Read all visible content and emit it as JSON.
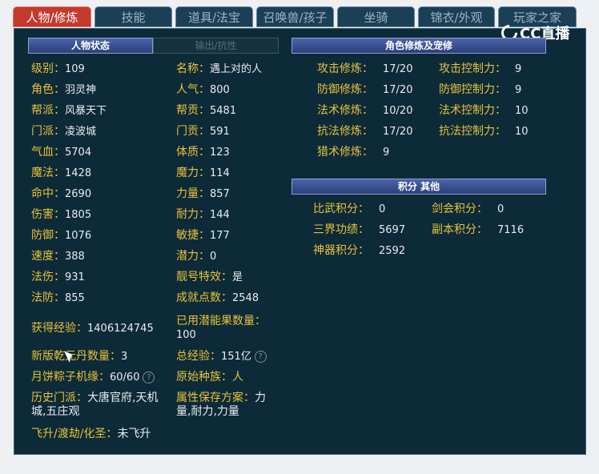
{
  "tabs": [
    "人物/修炼",
    "技能",
    "道具/法宝",
    "召唤兽/孩子",
    "坐骑",
    "锦衣/外观",
    "玩家之家"
  ],
  "logo_text": "CC直播",
  "section_headers": {
    "status_tab": "人物状态",
    "output_tab": "输出/抗性",
    "cultivation": "角色修炼及宠修",
    "points": "积分 其他"
  },
  "left_col": [
    {
      "label": "级别：",
      "value": "109"
    },
    {
      "label": "角色：",
      "value": "羽灵神"
    },
    {
      "label": "帮派：",
      "value": "风暴天下"
    },
    {
      "label": "门派：",
      "value": "凌波城"
    },
    {
      "label": "气血：",
      "value": "5704"
    },
    {
      "label": "魔法：",
      "value": "1428"
    },
    {
      "label": "命中：",
      "value": "2690"
    },
    {
      "label": "伤害：",
      "value": "1805"
    },
    {
      "label": "防御：",
      "value": "1076"
    },
    {
      "label": "速度：",
      "value": "388"
    },
    {
      "label": "法伤：",
      "value": "931"
    },
    {
      "label": "法防：",
      "value": "855"
    }
  ],
  "right_col": [
    {
      "label": "名称：",
      "value": "遇上对的人"
    },
    {
      "label": "人气：",
      "value": "800"
    },
    {
      "label": "帮贡：",
      "value": "5481"
    },
    {
      "label": "门贡：",
      "value": "591"
    },
    {
      "label": "体质：",
      "value": "123"
    },
    {
      "label": "魔力：",
      "value": "114"
    },
    {
      "label": "力量：",
      "value": "857"
    },
    {
      "label": "耐力：",
      "value": "144"
    },
    {
      "label": "敏捷：",
      "value": "177"
    },
    {
      "label": "潜力：",
      "value": "0"
    },
    {
      "label": "靓号特效：",
      "value": "是"
    },
    {
      "label": "成就点数：",
      "value": "2548"
    }
  ],
  "extra": {
    "exp_label": "获得经验：",
    "exp_value": "1406124745",
    "potential_label": "已用潜能果数量：",
    "potential_value": "100",
    "qiankun_label": "新版乾元丹数量：",
    "qiankun_value": "3",
    "total_exp_label": "总经验：",
    "total_exp_value": "151亿",
    "mooncake_label": "月饼粽子机缘：",
    "mooncake_value": "60/60",
    "race_label": "原始种族：",
    "race_value": "人",
    "history_label": "历史门派：",
    "history_value": "大唐官府,天机城,五庄观",
    "scheme_label": "属性保存方案：",
    "scheme_value": "力量,耐力,力量",
    "ascend_label": "飞升/渡劫/化圣：",
    "ascend_value": "未飞升"
  },
  "cultivation": [
    {
      "label": "攻击修炼：",
      "value": "17/20",
      "label2": "攻击控制力：",
      "value2": "9"
    },
    {
      "label": "防御修炼：",
      "value": "17/20",
      "label2": "防御控制力：",
      "value2": "9"
    },
    {
      "label": "法术修炼：",
      "value": "10/20",
      "label2": "法术控制力：",
      "value2": "10"
    },
    {
      "label": "抗法修炼：",
      "value": "17/20",
      "label2": "抗法控制力：",
      "value2": "10"
    },
    {
      "label": "猎术修炼：",
      "value": "9"
    }
  ],
  "points": [
    {
      "label": "比武积分：",
      "value": "0",
      "label2": "剑会积分：",
      "value2": "0"
    },
    {
      "label": "三界功绩：",
      "value": "5697",
      "label2": "副本积分：",
      "value2": "7116"
    },
    {
      "label": "神器积分：",
      "value": "2592"
    }
  ]
}
